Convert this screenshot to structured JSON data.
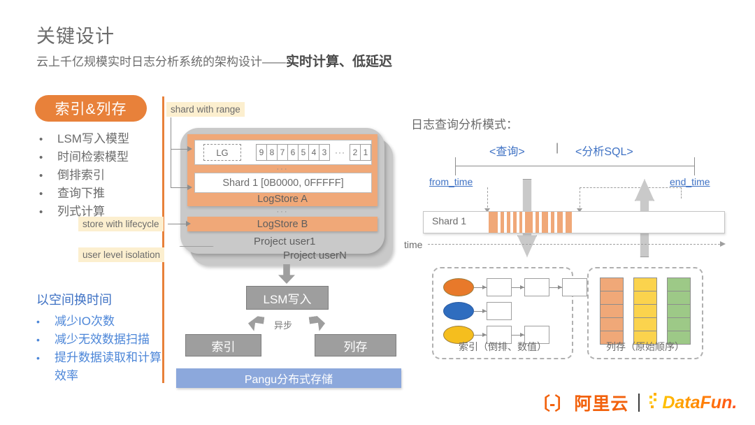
{
  "header": {
    "title": "关键设计",
    "subtitle_plain": "云上千亿规模实时日志分析系统的架构设计——",
    "subtitle_emphasis": "实时计算、低延迟"
  },
  "left": {
    "badge": "索引&列存",
    "features": [
      "LSM写入模型",
      "时间检索模型",
      "倒排索引",
      "查询下推",
      "列式计算"
    ],
    "tradeoff_title": "以空间换时间",
    "tradeoffs": [
      "减少IO次数",
      "减少无效数据扫描",
      "提升数据读取和计算效率"
    ]
  },
  "callouts": {
    "shard_with_range": "shard with range",
    "store_with_lifecycle": "store with lifecycle",
    "user_level_isolation": "user level isolation"
  },
  "architecture": {
    "lg_label": "LG",
    "lg_cells": [
      "9",
      "8",
      "7",
      "6",
      "5",
      "4",
      "3"
    ],
    "lg_ellipsis": "···",
    "lg_cells_tail": [
      "2",
      "1"
    ],
    "inner_dots": "···",
    "shard_range": "Shard 1 [0B0000, 0FFFFF]",
    "logstore_a": "LogStore A",
    "logstore_dots": "···",
    "logstore_b": "LogStore B",
    "project_user1": "Project user1",
    "project_usern": "Project userN"
  },
  "flow": {
    "lsm_write": "LSM写入",
    "async": "异步",
    "index": "索引",
    "column_store": "列存",
    "pangu": "Pangu分布式存储"
  },
  "right": {
    "query_mode_title": "日志查询分析模式：",
    "query_label": "<查询>",
    "range_separator": "|",
    "sql_label": "<分析SQL>",
    "from_time": "from_time",
    "end_time": "end_time",
    "shard_label": "Shard 1",
    "time_label": "time",
    "index_panel_caption": "索引（倒排、数值）",
    "column_panel_caption": "列存（原始顺序）"
  },
  "footer": {
    "aliyun_mark": "〔-〕",
    "aliyun_text": "阿里云",
    "separator": "|",
    "datafun_text": "DataFun."
  },
  "colors": {
    "accent_orange": "#E8813A",
    "panel_orange": "#F0A878",
    "gray_box": "#9E9E9E",
    "pangu_blue": "#8CA8DC",
    "link_blue": "#3F72C4",
    "callout_yellow": "#FCEFCF",
    "ellipse_orange": "#E8792A",
    "ellipse_blue": "#2F6DBF",
    "ellipse_yellow": "#F5BE1E",
    "col_orange": "#F0A878",
    "col_yellow": "#FBD34D",
    "col_green": "#9DC987"
  },
  "chart_data": {
    "type": "table",
    "title": "索引与列存结构",
    "index_rows": [
      {
        "key_color": "#E8792A",
        "boxes": 3
      },
      {
        "key_color": "#2F6DBF",
        "boxes": 1
      },
      {
        "key_color": "#F5BE1E",
        "boxes": 2
      }
    ],
    "column_stacks": [
      {
        "color": "#F0A878",
        "cells": 5
      },
      {
        "color": "#FBD34D",
        "cells": 5
      },
      {
        "color": "#9DC987",
        "cells": 5
      }
    ],
    "shard_stripe_count": 11
  }
}
